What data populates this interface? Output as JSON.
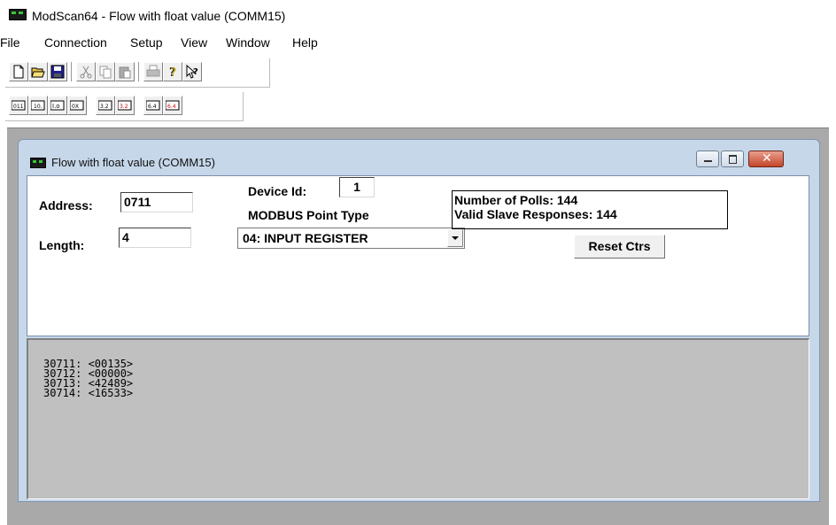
{
  "window": {
    "title": "ModScan64 - Flow with float value (COMM15)"
  },
  "menu": [
    "File",
    "Connection",
    "Setup",
    "View",
    "Window",
    "Help"
  ],
  "toolbar1": [
    "new-file-icon",
    "open-folder-icon",
    "save-disk-icon",
    "cut-scissors-icon",
    "copy-icon",
    "paste-icon",
    "print-icon",
    "help-icon",
    "context-help-icon"
  ],
  "toolbar2": [
    "binary-display-icon",
    "decimal-display-icon",
    "integer-display-icon",
    "hex-display-icon",
    "float-display-icon",
    "swapped-float-display-icon",
    "double-display-icon",
    "swapped-double-display-icon"
  ],
  "child": {
    "title": "Flow with float value (COMM15)",
    "address_label": "Address:",
    "address_value": "0711",
    "length_label": "Length:",
    "length_value": "4",
    "device_id_label": "Device Id:",
    "device_id_value": "1",
    "point_type_label": "MODBUS Point Type",
    "point_type_value": "04: INPUT REGISTER",
    "polls_text": "Number of Polls: 144",
    "responses_text": "Valid Slave Responses: 144",
    "reset_label": "Reset Ctrs",
    "registers": [
      "30711:  <00135>",
      "30712:  <00000>",
      "30713:  <42489>",
      "30714:  <16533>"
    ]
  }
}
